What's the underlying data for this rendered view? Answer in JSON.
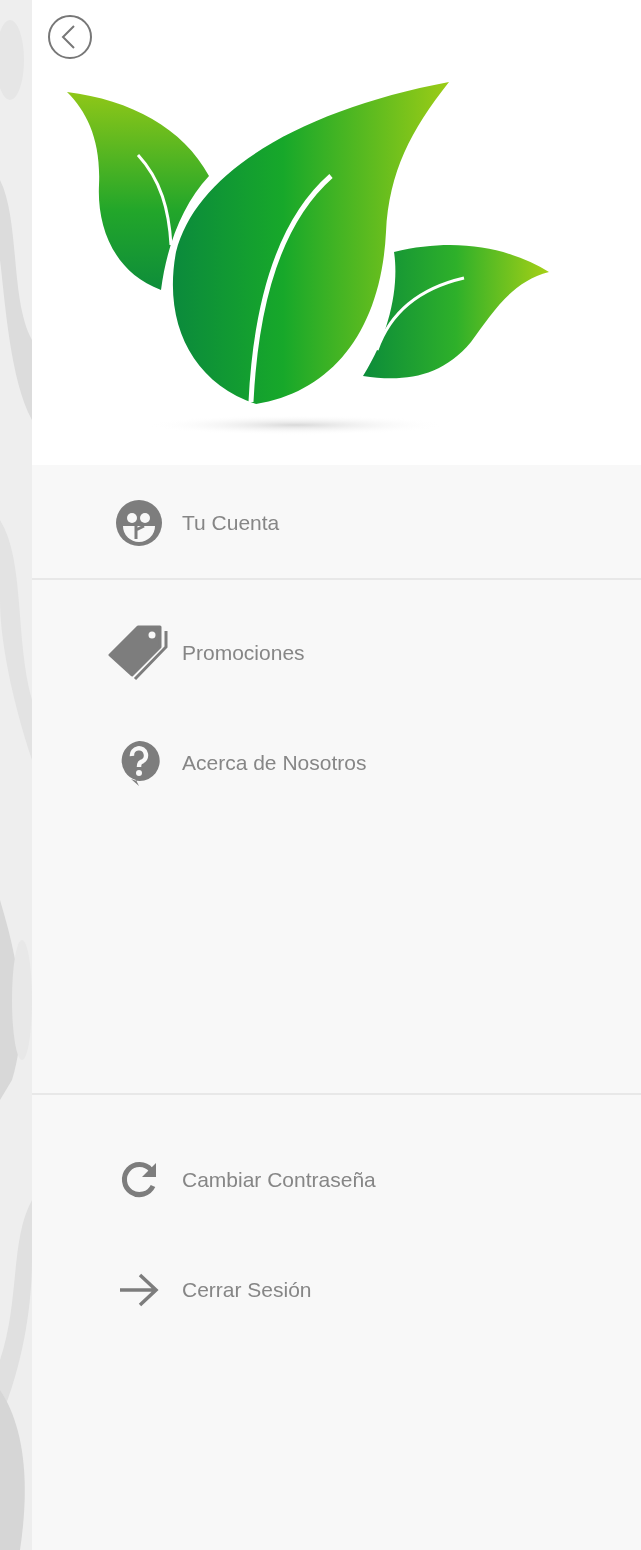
{
  "menu_groups": [
    [
      {
        "label": "Tu Cuenta"
      }
    ],
    [
      {
        "label": "Promociones"
      },
      {
        "label": "Acerca de Nosotros"
      }
    ],
    [
      {
        "label": "Cambiar Contraseña"
      },
      {
        "label": "Cerrar Sesión"
      }
    ]
  ]
}
